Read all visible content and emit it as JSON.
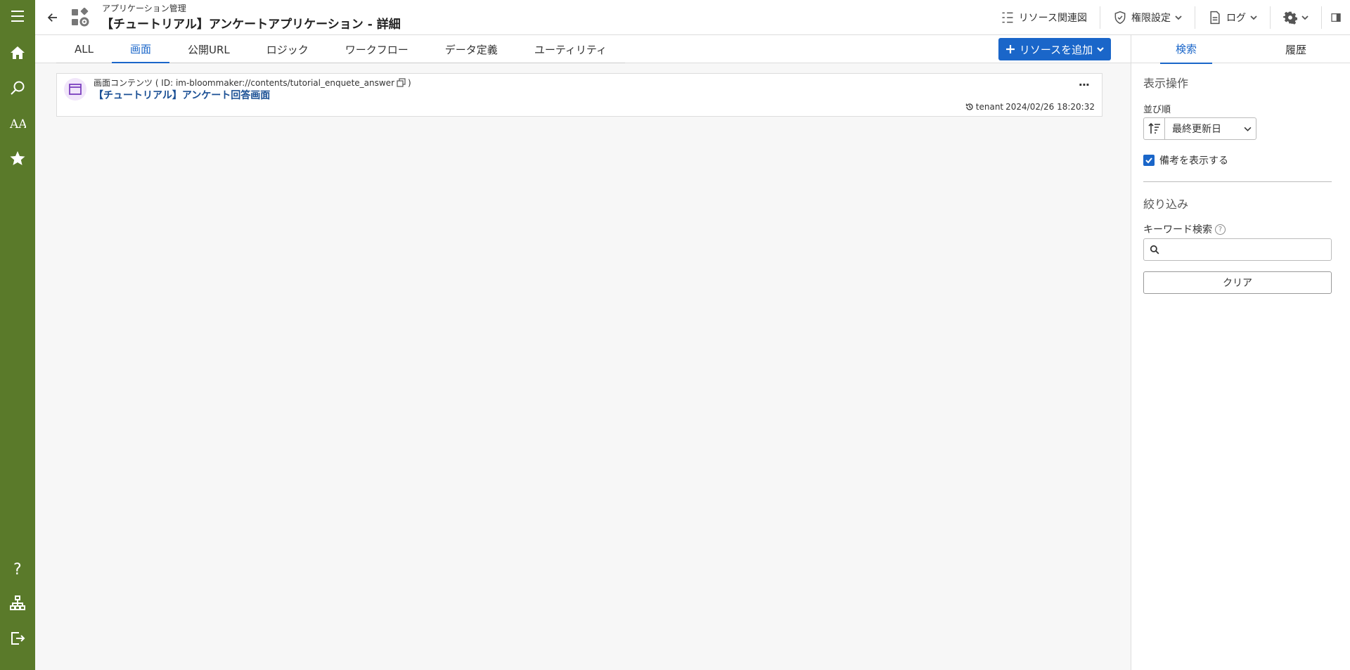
{
  "colors": {
    "sidebar": "#5a7a2a",
    "accent": "#1a66c9",
    "card_icon_bg": "#f1e6fa",
    "card_icon": "#7b3fbf"
  },
  "sidebar": {
    "items": [
      {
        "icon": "menu-icon"
      },
      {
        "icon": "home-icon"
      },
      {
        "icon": "search-icon"
      },
      {
        "icon": "font-icon"
      },
      {
        "icon": "star-icon"
      },
      {
        "icon": "help-icon"
      },
      {
        "icon": "sitemap-icon"
      },
      {
        "icon": "logout-icon"
      }
    ]
  },
  "header": {
    "breadcrumb": "アプリケーション管理",
    "title": "【チュートリアル】アンケートアプリケーション - 詳細",
    "actions": {
      "resource_map": "リソース関連図",
      "permissions": "権限設定",
      "log": "ログ"
    }
  },
  "tabs": [
    {
      "label": "ALL"
    },
    {
      "label": "画面"
    },
    {
      "label": "公開URL"
    },
    {
      "label": "ロジック"
    },
    {
      "label": "ワークフロー"
    },
    {
      "label": "データ定義"
    },
    {
      "label": "ユーティリティ"
    }
  ],
  "active_tab": "画面",
  "add_resource_label": "リソースを追加",
  "card": {
    "type_label": "画面コンテンツ ( ID: im-bloommaker://contents/tutorial_enquete_answer",
    "type_close": ")",
    "name": "【チュートリアル】アンケート回答画面",
    "user": "tenant",
    "updated": "2024/02/26 18:20:32"
  },
  "right_panel": {
    "tabs": [
      "検索",
      "履歴"
    ],
    "display_section": "表示操作",
    "sort_label": "並び順",
    "sort_value": "最終更新日",
    "show_notes_label": "備考を表示する",
    "show_notes_checked": true,
    "filter_section": "絞り込み",
    "keyword_label": "キーワード検索",
    "keyword_value": "",
    "clear_label": "クリア"
  }
}
